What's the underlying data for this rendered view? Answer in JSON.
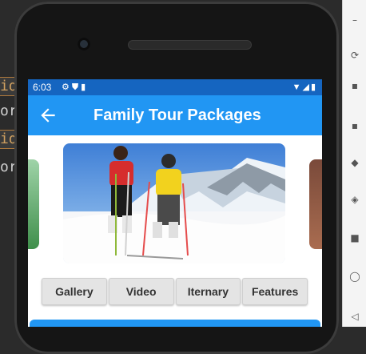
{
  "status_bar": {
    "time": "6:03",
    "left_icons": [
      "gear-icon",
      "shield-icon",
      "sd-card-icon"
    ],
    "right_icons": [
      "wifi-icon",
      "signal-icon",
      "battery-icon"
    ]
  },
  "app_bar": {
    "title": "Family Tour Packages",
    "back_icon": "arrow-back-icon"
  },
  "tabs": [
    {
      "label": "Gallery"
    },
    {
      "label": "Video"
    },
    {
      "label": "Iternary"
    },
    {
      "label": "Features"
    }
  ],
  "ide_code_fragments": [
    "id",
    "or",
    "id",
    "or"
  ],
  "colors": {
    "primary": "#2196f3",
    "status_bar": "#1565c0",
    "tab_bg": "#e4e4e4"
  }
}
